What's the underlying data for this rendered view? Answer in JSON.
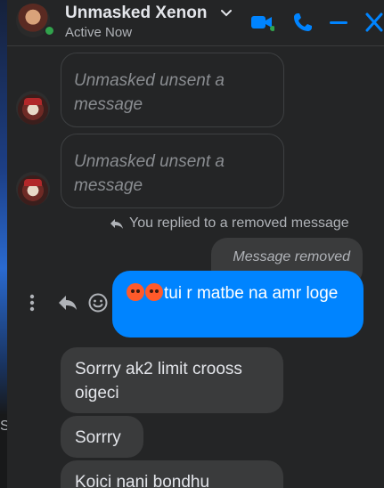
{
  "header": {
    "name": "Unmasked Xenon",
    "status": "Active Now"
  },
  "messages": {
    "unsent_1": "Unmasked unsent a message",
    "unsent_2": "Unmasked unsent a message",
    "replied_note": "You replied to a removed message",
    "removed_label": "Message removed",
    "sent_text": "tui r matbe na amr loge",
    "received": [
      "Sorrry ak2 limit crooss oigeci",
      "Sorrry",
      "Koici nani bondhu"
    ]
  },
  "colors": {
    "accent": "#0084ff",
    "online": "#31a24c",
    "background": "#242526",
    "bubble": "#3a3b3c"
  },
  "icons": [
    "video-call-icon",
    "phone-icon",
    "minimize-icon",
    "close-icon",
    "more-options-icon",
    "reply-icon",
    "emoji-react-icon"
  ]
}
